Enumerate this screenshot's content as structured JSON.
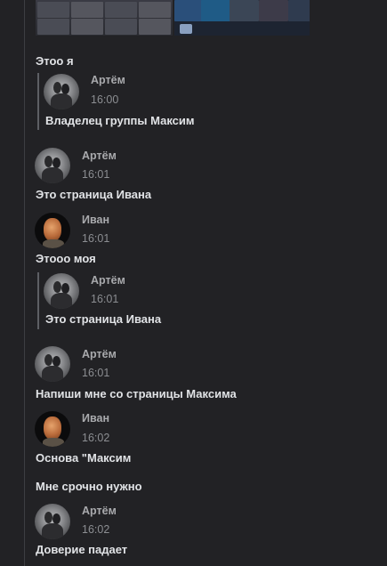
{
  "images": {
    "attachment1": "inventory-screenshot",
    "attachment2": "items-screenshot"
  },
  "messages": [
    {
      "kind": "text",
      "text": "Этоо я"
    },
    {
      "kind": "forward",
      "author": "Артём",
      "time": "16:00",
      "text": "Владелец группы Максим"
    },
    {
      "kind": "message",
      "author": "Артём",
      "time": "16:01",
      "text": "Это страница Ивана"
    },
    {
      "kind": "message",
      "author": "Иван",
      "time": "16:01",
      "text": "Этооо моя"
    },
    {
      "kind": "forward",
      "author": "Артём",
      "time": "16:01",
      "text": "Это страница Ивана"
    },
    {
      "kind": "message",
      "author": "Артём",
      "time": "16:01",
      "text": "Напиши мне со страницы Максима"
    },
    {
      "kind": "message",
      "author": "Иван",
      "time": "16:02",
      "text": "Основа \"Максим"
    },
    {
      "kind": "text",
      "text": "Мне срочно нужно"
    },
    {
      "kind": "message",
      "author": "Артём",
      "time": "16:02",
      "text": "Доверие падает"
    }
  ],
  "colors": {
    "background": "#222225",
    "text": "#e1e3e6",
    "author": "#a9aaad",
    "time": "#8c8e92"
  }
}
